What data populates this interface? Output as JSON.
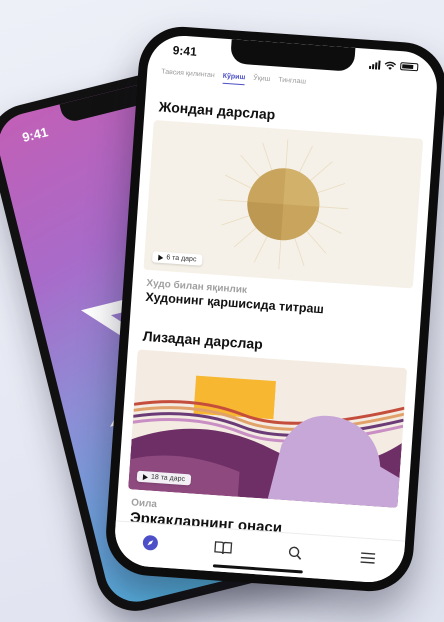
{
  "back_phone": {
    "time": "9:41",
    "gradient": [
      "#c25fb6",
      "#8d8fd6",
      "#4bbde6"
    ]
  },
  "front_phone": {
    "time": "9:41",
    "tabs": [
      {
        "label": "Тавсия қилинган",
        "active": false
      },
      {
        "label": "Кўриш",
        "active": true
      },
      {
        "label": "Ўқиш",
        "active": false
      },
      {
        "label": "Тинглаш",
        "active": false
      }
    ],
    "sections": [
      {
        "title": "Жондан дарслар",
        "badge": "6 та дарс",
        "kicker": "Худо билан яқинлик",
        "headline": "Худонинг қаршисида титраш"
      },
      {
        "title": "Лизадан дарслар",
        "badge": "18 та дарс",
        "kicker": "Оила",
        "headline": "Эркакларнинг онаси"
      }
    ],
    "nav": [
      "compass-icon",
      "book-icon",
      "search-icon",
      "menu-icon"
    ],
    "accent": "#4c4fc7"
  }
}
